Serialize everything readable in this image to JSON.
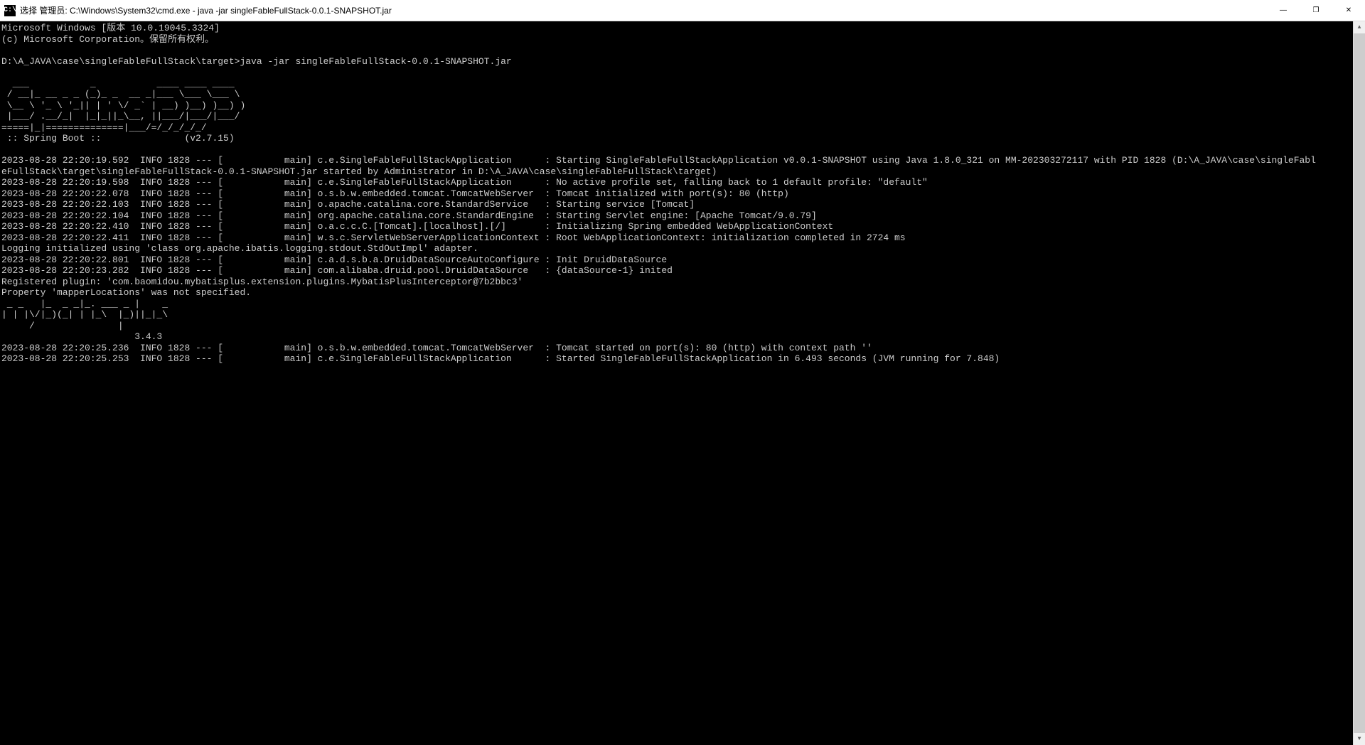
{
  "titlebar": {
    "icon_label": "cmd-icon",
    "title": "选择 管理员: C:\\Windows\\System32\\cmd.exe - java  -jar singleFableFullStack-0.0.1-SNAPSHOT.jar"
  },
  "window_controls": {
    "minimize": "—",
    "maximize": "❐",
    "close": "✕"
  },
  "terminal": {
    "lines": [
      "Microsoft Windows [版本 10.0.19045.3324]",
      "(c) Microsoft Corporation。保留所有权利。",
      "",
      "D:\\A_JAVA\\case\\singleFableFullStack\\target>java -jar singleFableFullStack-0.0.1-SNAPSHOT.jar",
      "",
      "  ___           _           ____ ____ ____",
      " / __|_ __ _ _ (_)_ _  __ _|___ \\___ \\___ \\",
      " \\__ \\ '_ \\ '_|| | ' \\/ _` | __) )__) )__) )",
      " |___/ .__/_|  |_|_||_\\__, ||___/|___/|___/",
      "=====|_|==============|___/=/_/_/_/_/",
      " :: Spring Boot ::               (v2.7.15)",
      "",
      "2023-08-28 22:20:19.592  INFO 1828 --- [           main] c.e.SingleFableFullStackApplication      : Starting SingleFableFullStackApplication v0.0.1-SNAPSHOT using Java 1.8.0_321 on MM-202303272117 with PID 1828 (D:\\A_JAVA\\case\\singleFabl",
      "eFullStack\\target\\singleFableFullStack-0.0.1-SNAPSHOT.jar started by Administrator in D:\\A_JAVA\\case\\singleFableFullStack\\target)",
      "2023-08-28 22:20:19.598  INFO 1828 --- [           main] c.e.SingleFableFullStackApplication      : No active profile set, falling back to 1 default profile: \"default\"",
      "2023-08-28 22:20:22.078  INFO 1828 --- [           main] o.s.b.w.embedded.tomcat.TomcatWebServer  : Tomcat initialized with port(s): 80 (http)",
      "2023-08-28 22:20:22.103  INFO 1828 --- [           main] o.apache.catalina.core.StandardService   : Starting service [Tomcat]",
      "2023-08-28 22:20:22.104  INFO 1828 --- [           main] org.apache.catalina.core.StandardEngine  : Starting Servlet engine: [Apache Tomcat/9.0.79]",
      "2023-08-28 22:20:22.410  INFO 1828 --- [           main] o.a.c.c.C.[Tomcat].[localhost].[/]       : Initializing Spring embedded WebApplicationContext",
      "2023-08-28 22:20:22.411  INFO 1828 --- [           main] w.s.c.ServletWebServerApplicationContext : Root WebApplicationContext: initialization completed in 2724 ms",
      "Logging initialized using 'class org.apache.ibatis.logging.stdout.StdOutImpl' adapter.",
      "2023-08-28 22:20:22.801  INFO 1828 --- [           main] c.a.d.s.b.a.DruidDataSourceAutoConfigure : Init DruidDataSource",
      "2023-08-28 22:20:23.282  INFO 1828 --- [           main] com.alibaba.druid.pool.DruidDataSource   : {dataSource-1} inited",
      "Registered plugin: 'com.baomidou.mybatisplus.extension.plugins.MybatisPlusInterceptor@7b2bbc3'",
      "Property 'mapperLocations' was not specified.",
      " _ _   |_  _ _|_. ___ _ |    _",
      "| | |\\/|_)(_| | |_\\  |_)||_|_\\",
      "     /               |",
      "                        3.4.3",
      "2023-08-28 22:20:25.236  INFO 1828 --- [           main] o.s.b.w.embedded.tomcat.TomcatWebServer  : Tomcat started on port(s): 80 (http) with context path ''",
      "2023-08-28 22:20:25.253  INFO 1828 --- [           main] c.e.SingleFableFullStackApplication      : Started SingleFableFullStackApplication in 6.493 seconds (JVM running for 7.848)"
    ]
  },
  "scrollbar": {
    "up_arrow": "▲",
    "down_arrow": "▼"
  }
}
